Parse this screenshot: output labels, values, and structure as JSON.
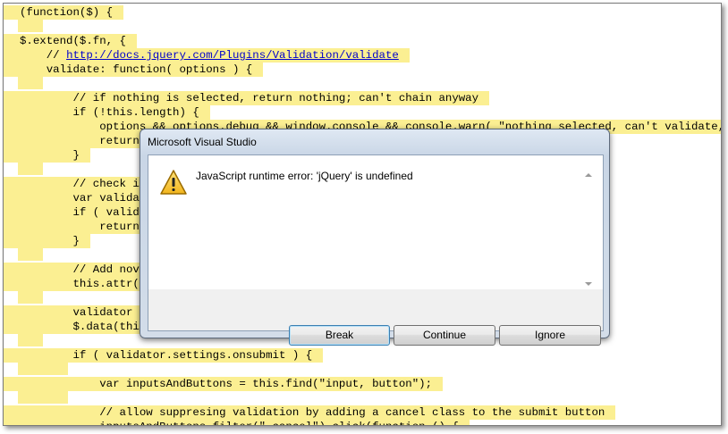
{
  "code": {
    "lines": [
      {
        "pre": "(function($) {",
        "link": "",
        "post": "",
        "indent": 0
      },
      {
        "pre": "",
        "link": "",
        "post": "",
        "indent": 0,
        "blank": true
      },
      {
        "pre": "$.extend($.fn, {",
        "link": "",
        "post": "",
        "indent": 0
      },
      {
        "pre": "    // ",
        "link": "http://docs.jquery.com/Plugins/Validation/validate",
        "post": "",
        "indent": 0
      },
      {
        "pre": "    validate: function( options ) {",
        "link": "",
        "post": "",
        "indent": 0
      },
      {
        "pre": "",
        "link": "",
        "post": "",
        "indent": 1,
        "blank": true
      },
      {
        "pre": "        // if nothing is selected, return nothing; can't chain anyway",
        "link": "",
        "post": "",
        "indent": 0
      },
      {
        "pre": "        if (!this.length) {",
        "link": "",
        "post": "",
        "indent": 0
      },
      {
        "pre": "            options && options.debug && window.console && console.warn( \"nothing selected, can't validate, returning nothing\" );",
        "link": "",
        "post": "",
        "indent": 0
      },
      {
        "pre": "            return;",
        "link": "",
        "post": "",
        "indent": 0
      },
      {
        "pre": "        }",
        "link": "",
        "post": "",
        "indent": 0
      },
      {
        "pre": "",
        "link": "",
        "post": "",
        "indent": 1,
        "blank": true
      },
      {
        "pre": "        // check if",
        "link": "",
        "post": "",
        "indent": 0
      },
      {
        "pre": "        var validat",
        "link": "",
        "post": "",
        "indent": 0
      },
      {
        "pre": "        if ( valida",
        "link": "",
        "post": "",
        "indent": 0
      },
      {
        "pre": "            return",
        "link": "",
        "post": "",
        "indent": 0
      },
      {
        "pre": "        }",
        "link": "",
        "post": "",
        "indent": 0
      },
      {
        "pre": "",
        "link": "",
        "post": "",
        "indent": 1,
        "blank": true
      },
      {
        "pre": "        // Add nova",
        "link": "",
        "post": "",
        "indent": 0
      },
      {
        "pre": "        this.attr('",
        "link": "",
        "post": "",
        "indent": 0
      },
      {
        "pre": "",
        "link": "",
        "post": "",
        "indent": 1,
        "blank": true
      },
      {
        "pre": "        validator =",
        "link": "",
        "post": "",
        "indent": 0
      },
      {
        "pre": "        $.data(this",
        "link": "",
        "post": "",
        "indent": 0
      },
      {
        "pre": "",
        "link": "",
        "post": "",
        "indent": 1,
        "blank": true
      },
      {
        "pre": "        if ( validator.settings.onsubmit ) {",
        "link": "",
        "post": "",
        "indent": 0
      },
      {
        "pre": "",
        "link": "",
        "post": "",
        "indent": 2,
        "blank": true
      },
      {
        "pre": "            var inputsAndButtons = this.find(\"input, button\");",
        "link": "",
        "post": "",
        "indent": 0
      },
      {
        "pre": "",
        "link": "",
        "post": "",
        "indent": 2,
        "blank": true
      },
      {
        "pre": "            // allow suppresing validation by adding a cancel class to the submit button",
        "link": "",
        "post": "",
        "indent": 0
      },
      {
        "pre": "            inputsAndButtons.filter(\".cancel\").click(function () {",
        "link": "",
        "post": "",
        "indent": 0
      }
    ],
    "highlight_color": "#fbef92"
  },
  "dialog": {
    "title": "Microsoft Visual Studio",
    "icon": "warning-icon",
    "message": "JavaScript runtime error: 'jQuery' is undefined",
    "buttons": {
      "break_label": "Break",
      "continue_label": "Continue",
      "ignore_label": "Ignore"
    }
  }
}
